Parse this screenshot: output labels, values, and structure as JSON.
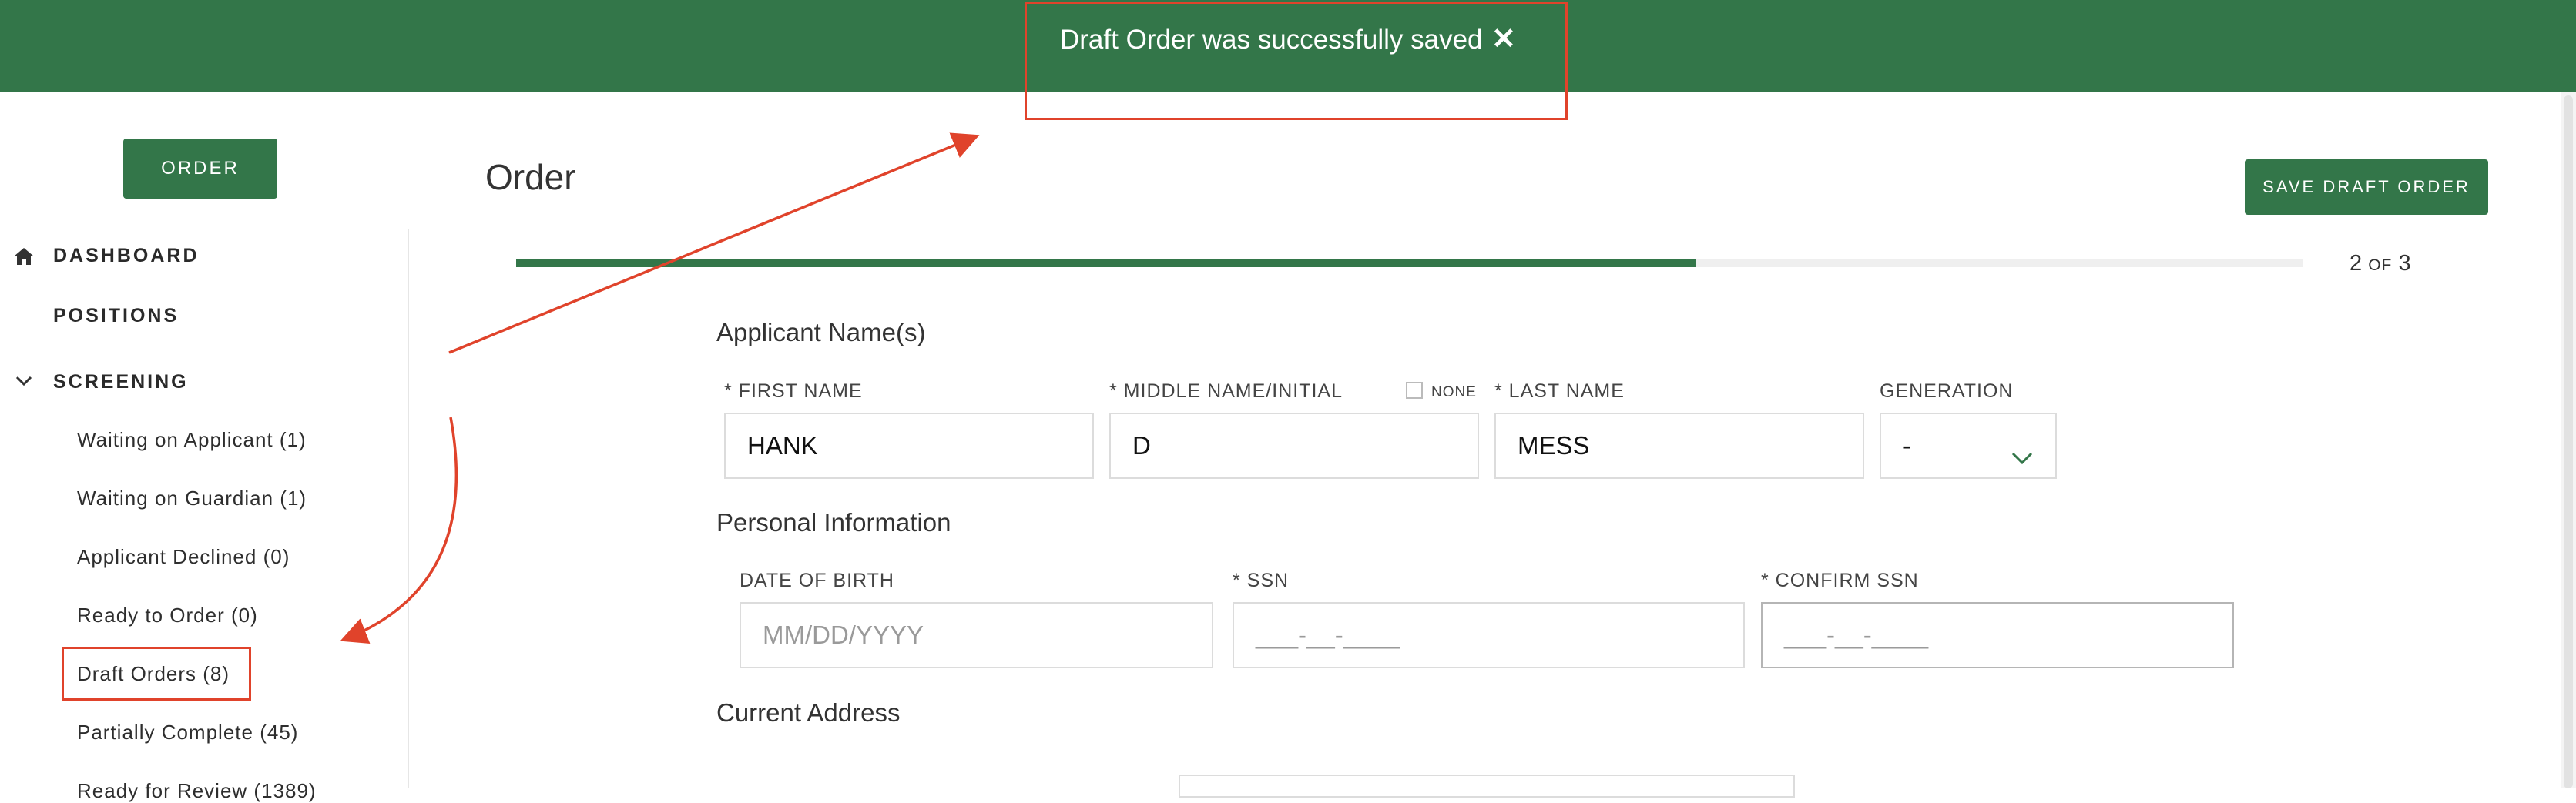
{
  "toast": {
    "message": "Draft Order was successfully saved",
    "close_icon": "close-icon",
    "close_glyph": "✕"
  },
  "sidebar": {
    "order_button": "ORDER",
    "nav": [
      {
        "label": "DASHBOARD",
        "icon": "home-icon"
      },
      {
        "label": "POSITIONS"
      },
      {
        "label": "SCREENING",
        "icon": "chevron-down-icon",
        "expanded": true
      }
    ],
    "screening_items": [
      {
        "label": "Waiting on Applicant (1)"
      },
      {
        "label": "Waiting on Guardian (1)"
      },
      {
        "label": "Applicant Declined (0)"
      },
      {
        "label": "Ready to Order (0)"
      },
      {
        "label": "Draft Orders (8)",
        "highlighted": true
      },
      {
        "label": "Partially Complete (45)"
      },
      {
        "label": "Ready for Review (1389)"
      }
    ]
  },
  "header": {
    "title": "Order",
    "save_draft_button": "SAVE DRAFT ORDER"
  },
  "progress": {
    "step": "2",
    "of": "OF",
    "total": "3",
    "fraction": 0.66
  },
  "applicant_names": {
    "section_title": "Applicant Name(s)",
    "first_name": {
      "label": "* FIRST NAME",
      "value": "HANK"
    },
    "middle_name": {
      "label": "* MIDDLE NAME/INITIAL",
      "value": "D",
      "none_label": "NONE"
    },
    "last_name": {
      "label": "* LAST NAME",
      "value": "MESS"
    },
    "generation": {
      "label": "GENERATION",
      "value": "-"
    }
  },
  "personal_info": {
    "section_title": "Personal Information",
    "dob": {
      "label": "DATE OF BIRTH",
      "placeholder": "MM/DD/YYYY"
    },
    "ssn": {
      "label": "* SSN",
      "placeholder": "___-__-____"
    },
    "confirm_ssn": {
      "label": "* CONFIRM SSN",
      "placeholder": "___-__-____"
    }
  },
  "current_address": {
    "section_title": "Current Address"
  },
  "colors": {
    "brand_green": "#337649",
    "annotation_red": "#e0432b"
  }
}
